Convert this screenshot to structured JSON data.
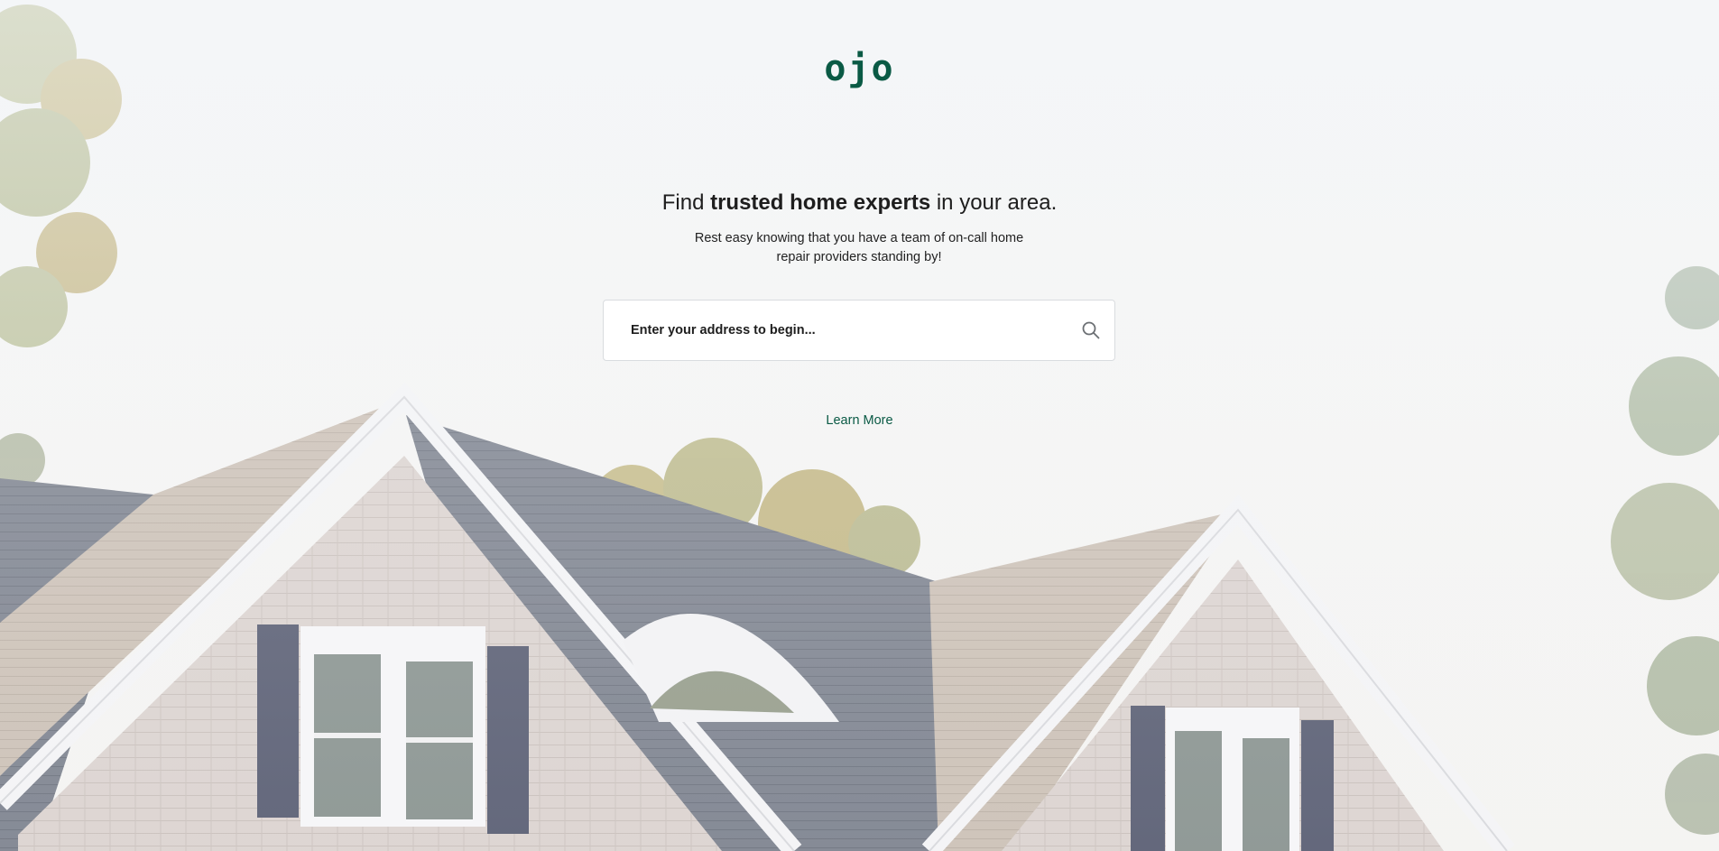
{
  "brand": {
    "logo_text": "ojo",
    "color": "#0a5a45"
  },
  "hero": {
    "headline_prefix": "Find ",
    "headline_bold": "trusted home experts",
    "headline_suffix": " in your area.",
    "subtext": "Rest easy knowing that you have a team of on-call home repair providers standing by!"
  },
  "search": {
    "placeholder": "Enter your address to begin...",
    "value": "",
    "icon": "search-icon"
  },
  "links": {
    "learn_more": "Learn More"
  },
  "background": {
    "description_icon": "house-photo",
    "roof_color": "#6b7280",
    "siding_color": "#d8cfcb",
    "shutter_color": "#4a4f66"
  }
}
